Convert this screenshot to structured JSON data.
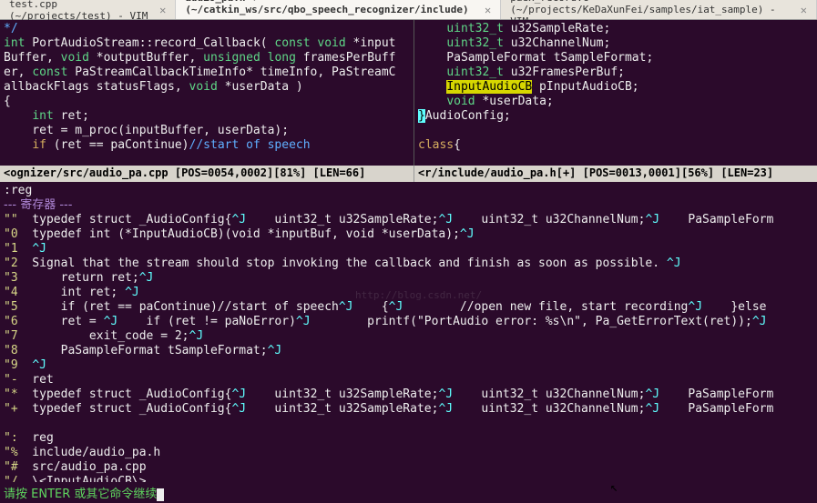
{
  "tabs": [
    {
      "label": "test.cpp (~/projects/test) - VIM",
      "close": "✕",
      "active": false
    },
    {
      "label": "audio_pa.h + (~/catkin_ws/src/qbo_speech_recognizer/include) ...",
      "close": "✕",
      "active": true
    },
    {
      "label": "paex_record.c (~/projects/KeDaXunFei/samples/iat_sample) - VIM",
      "close": "✕",
      "active": false
    }
  ],
  "left_pane": {
    "l0a": "*/",
    "l1_int": "int",
    "l1_rest": " PortAudioStream::record_Callback( ",
    "l1_const": "const",
    "l1_void": " void",
    "l1_in": " *input",
    "l2a": "Buffer, ",
    "l2_void": "void",
    "l2b": " *outputBuffer, ",
    "l2_ul": "unsigned long",
    "l2c": " framesPerBuff",
    "l3a": "er, ",
    "l3_const": "const",
    "l3b": " PaStreamCallbackTimeInfo* timeInfo, PaStreamC",
    "l4a": "allbackFlags statusFlags, ",
    "l4_void": "void",
    "l4b": " *userData )",
    "l5": "{",
    "l6a": "    ",
    "l6_int": "int",
    "l6b": " ret;",
    "l7": "    ret = m_proc(inputBuffer, userData);",
    "l8a": "    ",
    "l8_if": "if",
    "l8b": " (ret == paContinue)",
    "l8c": "//start of speech"
  },
  "right_pane": {
    "l0a": "    ",
    "l0_t": "uint32_t",
    "l0b": " u32SampleRate;",
    "l1a": "    ",
    "l1_t": "uint32_t",
    "l1b": " u32ChannelNum;",
    "l2": "    PaSampleFormat tSampleFormat;",
    "l3a": "    ",
    "l3_t": "uint32_t",
    "l3b": " u32FramesPerBuf;",
    "l4a": "    ",
    "l4_hl": "InputAudioCB",
    "l4b": " pInputAudioCB;",
    "l5a": "    ",
    "l5_void": "void",
    "l5b": " *userData;",
    "l6a": "}",
    "l6b": "AudioConfig;",
    "l7": "",
    "l8a": "class",
    "l8b": "{"
  },
  "status": {
    "left": "<ognizer/src/audio_pa.cpp [POS=0054,0002][81%] [LEN=66]",
    "right": "<r/include/audio_pa.h[+] [POS=0013,0001][56%] [LEN=23]"
  },
  "reg": {
    "cmd": ":reg",
    "header": "--- 寄存器 ---",
    "rows": [
      {
        "k": "\"\"",
        "v": "  typedef struct _AudioConfig{^J    uint32_t u32SampleRate;^J    uint32_t u32ChannelNum;^J    PaSampleForm"
      },
      {
        "k": "\"0",
        "v": "  typedef int (*InputAudioCB)(void *inputBuf, void *userData);^J"
      },
      {
        "k": "\"1",
        "v": "  ^J"
      },
      {
        "k": "\"2",
        "v": "  Signal that the stream should stop invoking the callback and finish as soon as possible. ^J"
      },
      {
        "k": "\"3",
        "v": "      return ret;^J"
      },
      {
        "k": "\"4",
        "v": "      int ret; ^J"
      },
      {
        "k": "\"5",
        "v": "      if (ret == paContinue)//start of speech^J    {^J        //open new file, start recording^J    }else"
      },
      {
        "k": "\"6",
        "v": "      ret = ^J    if (ret != paNoError)^J        printf(\"PortAudio error: %s\\n\", Pa_GetErrorText(ret));^J"
      },
      {
        "k": "\"7",
        "v": "          exit_code = 2;^J"
      },
      {
        "k": "\"8",
        "v": "      PaSampleFormat tSampleFormat;^J"
      },
      {
        "k": "\"9",
        "v": "  ^J"
      },
      {
        "k": "\"-",
        "v": "  ret"
      },
      {
        "k": "\"*",
        "v": "  typedef struct _AudioConfig{^J    uint32_t u32SampleRate;^J    uint32_t u32ChannelNum;^J    PaSampleForm"
      },
      {
        "k": "\"+",
        "v": "  typedef struct _AudioConfig{^J    uint32_t u32SampleRate;^J    uint32_t u32ChannelNum;^J    PaSampleForm"
      },
      {
        "k": "",
        "v": ""
      },
      {
        "k": "\":",
        "v": "  reg"
      },
      {
        "k": "\"%",
        "v": "  include/audio_pa.h"
      },
      {
        "k": "\"#",
        "v": "  src/audio_pa.cpp"
      },
      {
        "k": "\"/",
        "v": "  \\<InputAudioCB\\>"
      }
    ]
  },
  "prompt": "请按 ENTER 或其它命令继续",
  "watermark": "http://blog.csdn.net/"
}
